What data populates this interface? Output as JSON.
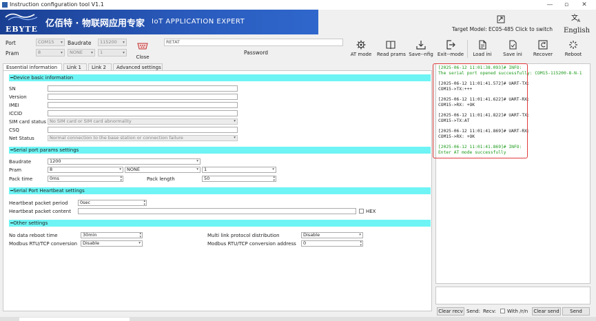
{
  "window": {
    "title": "Instruction configuration tool V1.1",
    "controls": [
      "—",
      "▫",
      "✕"
    ]
  },
  "banner": {
    "brand": "EBYTE",
    "title_cn": "亿佰特 · 物联网应用专家",
    "title_en": "IoT APPLICATION EXPERT"
  },
  "header": {
    "target_model": "Target Model: EC05-485 Click to switch",
    "language": "English"
  },
  "serial": {
    "port_label": "Port",
    "port_value": "COM15",
    "baud_label": "Baudrate",
    "baud_value": "115200",
    "pram_label": "Pram",
    "pram_data": "8",
    "pram_parity": "NONE",
    "pram_stop": "1",
    "close_label": "Close",
    "password_value": "RETAT",
    "password_label": "Password"
  },
  "toolbar": [
    {
      "name": "at-mode-button",
      "icon": "gear-icon",
      "label": "AT mode"
    },
    {
      "name": "read-params-button",
      "icon": "book-icon",
      "label": "Read prams"
    },
    {
      "name": "save-config-button",
      "icon": "download-icon",
      "label": "Save--nfig"
    },
    {
      "name": "exit-mode-button",
      "icon": "exit-icon",
      "label": "Exit--mode"
    },
    {
      "name": "load-ini-button",
      "icon": "document-icon",
      "label": "Load ini"
    },
    {
      "name": "save-ini-button",
      "icon": "save-doc-icon",
      "label": "Save ini"
    },
    {
      "name": "recover-button",
      "icon": "recover-icon",
      "label": "Recover"
    },
    {
      "name": "reboot-button",
      "icon": "loading-icon",
      "label": "Reboot"
    }
  ],
  "tabs": [
    "Essential information",
    "Link 1",
    "Link 2",
    "Advanced settings"
  ],
  "device": {
    "title": "Device basic information",
    "sn_label": "SN",
    "version_label": "Version",
    "imei_label": "IMEI",
    "iccid_label": "ICCID",
    "sim_label": "SIM card status",
    "sim_value": "No SIM card or SIM card abnormality",
    "csq_label": "CSQ",
    "net_label": "Net Status",
    "net_value": "Normal connection to the base station or connection failure"
  },
  "serial_params": {
    "title": "Serial port params settings",
    "baud_label": "Baudrate",
    "baud_value": "1200",
    "pram_label": "Pram",
    "data_value": "8",
    "parity_value": "NONE",
    "stop_value": "1",
    "pack_time_label": "Pack time",
    "pack_time_value": "0ms",
    "pack_length_label": "Pack length",
    "pack_length_value": "50"
  },
  "heartbeat": {
    "title": "Serial Port Heartbeat settings",
    "period_label": "Heartbeat packet period",
    "period_value": "0sec",
    "content_label": "Heartbeat packet content",
    "hex_label": "HEX"
  },
  "other": {
    "title": "Other settings",
    "reboot_label": "No data reboot time",
    "reboot_value": "30min",
    "multilink_label": "Multi link protocol distribution",
    "multilink_value": "Disable",
    "modbus_conv_label": "Modbus RTU/TCP conversion",
    "modbus_conv_value": "Disable",
    "modbus_addr_label": "Modbus RTU/TCP conversion address",
    "modbus_addr_value": "0"
  },
  "log": [
    {
      "type": "info",
      "text": "[2025-06-12 11:01:38.093]# INFO:\nThe serial port opened successfully: COM15-115200-8-N-1"
    },
    {
      "type": "normal",
      "text": "[2025-06-12 11:01:41.572]# UART-TX:\nCOM15->TX:+++"
    },
    {
      "type": "normal",
      "text": "[2025-06-12 11:01:41.622]# UART-RX:\nCOM15->RX: +OK"
    },
    {
      "type": "normal",
      "text": "[2025-06-12 11:01:41.822]# UART-TX:\nCOM15->TX:AT"
    },
    {
      "type": "normal",
      "text": "[2025-06-12 11:01:41.869]# UART-RX:\nCOM15->RX: +OK"
    },
    {
      "type": "info",
      "text": "[2025-06-12 11:01:41.869]# INFO:\nEnter AT mode successfully"
    }
  ],
  "bottom": {
    "clear_recv": "Clear recv",
    "send_label": "Send:",
    "recv_label": "Recv:",
    "with_rn": "With /r/n",
    "clear_send": "Clear send",
    "send_button": "Send"
  },
  "colors": {
    "section_header": "#6ef4f4",
    "banner": "#2a5bbd",
    "info_text": "#1a9a1a",
    "highlight": "#e03a3a"
  }
}
